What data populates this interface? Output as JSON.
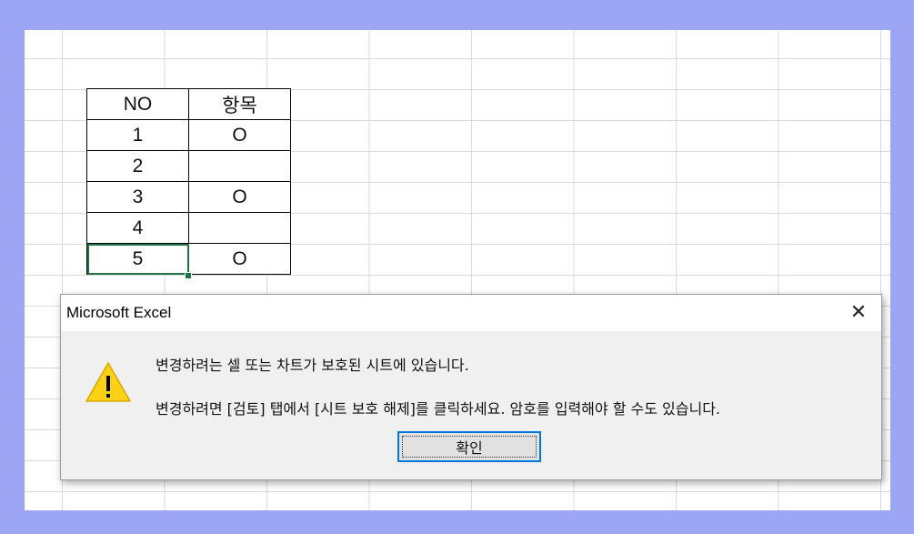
{
  "table": {
    "headers": [
      "NO",
      "항목"
    ],
    "rows": [
      [
        "1",
        "O"
      ],
      [
        "2",
        ""
      ],
      [
        "3",
        "O"
      ],
      [
        "4",
        ""
      ],
      [
        "5",
        "O"
      ]
    ]
  },
  "dialog": {
    "title": "Microsoft Excel",
    "close_glyph": "✕",
    "icon": "warning-icon",
    "message_line1": "변경하려는 셀 또는 차트가 보호된 시트에 있습니다.",
    "message_line2": "변경하려면 [검토] 탭에서 [시트 보호 해제]를 클릭하세요. 암호를 입력해야 할 수도 있습니다.",
    "ok_label": "확인"
  },
  "colors": {
    "background": "#9da5f5",
    "selection": "#217346",
    "button_focus": "#0078d7",
    "warning_fill": "#fcd116"
  }
}
